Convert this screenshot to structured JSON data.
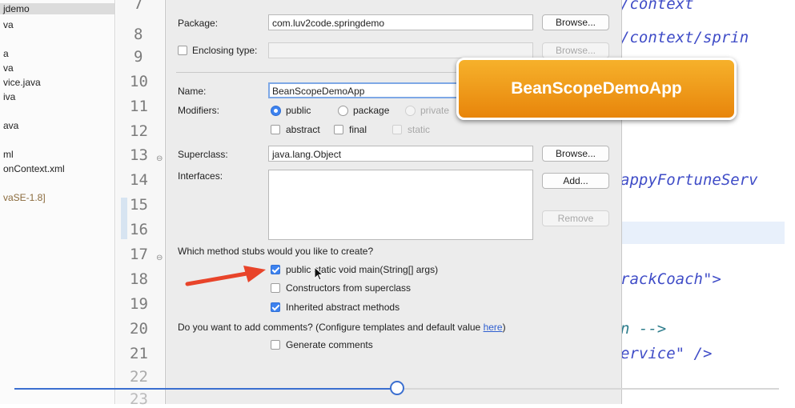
{
  "sidebar": {
    "items": [
      {
        "label": "jdemo",
        "selected": true
      },
      {
        "label": "va"
      },
      {
        "label": "a"
      },
      {
        "label": "va"
      },
      {
        "label": "vice.java"
      },
      {
        "label": "iva"
      },
      {
        "label": "ava"
      },
      {
        "label": "ml"
      },
      {
        "label": "onContext.xml"
      },
      {
        "label": "vaSE-1.8]"
      }
    ]
  },
  "editor": {
    "line_numbers": [
      "7",
      "8",
      "9",
      "10",
      "11",
      "12",
      "13",
      "14",
      "15",
      "16",
      "17",
      "18",
      "19",
      "20",
      "21",
      "22",
      "23"
    ],
    "code_lines": [
      "/context",
      "/context/sprin",
      "appyFortuneServ",
      "rackCoach\">",
      "n -->",
      "ervice\" />"
    ]
  },
  "dialog": {
    "package_label": "Package:",
    "package_value": "com.luv2code.springdemo",
    "browse_label": "Browse...",
    "enclosing_label": "Enclosing type:",
    "enclosing_browse_label": "Browse...",
    "name_label": "Name:",
    "name_value": "BeanScopeDemoApp",
    "modifiers_label": "Modifiers:",
    "mod_public": "public",
    "mod_package": "package",
    "mod_private": "private",
    "mod_abstract": "abstract",
    "mod_final": "final",
    "mod_static": "static",
    "superclass_label": "Superclass:",
    "superclass_value": "java.lang.Object",
    "superclass_browse_label": "Browse...",
    "interfaces_label": "Interfaces:",
    "add_label": "Add...",
    "remove_label": "Remove",
    "stubs_question": "Which method stubs would you like to create?",
    "stub_main": "public static void main(String[] args)",
    "stub_main_checked": true,
    "stub_constructors": "Constructors from superclass",
    "stub_constructors_checked": false,
    "stub_inherited": "Inherited abstract methods",
    "stub_inherited_checked": true,
    "comments_question": "Do you want to add comments? (Configure templates and default value ",
    "comments_link": "here",
    "comments_close": ")",
    "generate_comments": "Generate comments",
    "generate_comments_checked": false
  },
  "callout": {
    "text": "BeanScopeDemoApp"
  },
  "player": {
    "progress": 0.5
  },
  "colors": {
    "accent": "#3d82ef",
    "callout": "#f0a01f",
    "arrow": "#e8442a",
    "code": "#3f4cc7",
    "scrubber": "#3b6fd0"
  }
}
